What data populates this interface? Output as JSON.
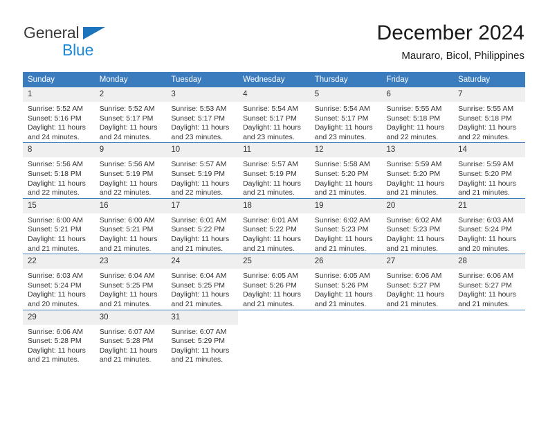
{
  "brand": {
    "name_part1": "General",
    "name_part2": "Blue",
    "triangle_color": "#1c75bc"
  },
  "header": {
    "title": "December 2024",
    "subtitle": "Mauraro, Bicol, Philippines"
  },
  "colors": {
    "header_blue": "#3b7cbf",
    "daynum_gray": "#efefef",
    "brand_blue": "#1c8ad6",
    "text": "#333333"
  },
  "weekday_headers": [
    "Sunday",
    "Monday",
    "Tuesday",
    "Wednesday",
    "Thursday",
    "Friday",
    "Saturday"
  ],
  "labels": {
    "sunrise_prefix": "Sunrise:",
    "sunset_prefix": "Sunset:",
    "daylight_prefix": "Daylight:"
  },
  "weeks": [
    [
      {
        "day": "1",
        "sunrise": "Sunrise: 5:52 AM",
        "sunset": "Sunset: 5:16 PM",
        "daylight": "Daylight: 11 hours and 24 minutes."
      },
      {
        "day": "2",
        "sunrise": "Sunrise: 5:52 AM",
        "sunset": "Sunset: 5:17 PM",
        "daylight": "Daylight: 11 hours and 24 minutes."
      },
      {
        "day": "3",
        "sunrise": "Sunrise: 5:53 AM",
        "sunset": "Sunset: 5:17 PM",
        "daylight": "Daylight: 11 hours and 23 minutes."
      },
      {
        "day": "4",
        "sunrise": "Sunrise: 5:54 AM",
        "sunset": "Sunset: 5:17 PM",
        "daylight": "Daylight: 11 hours and 23 minutes."
      },
      {
        "day": "5",
        "sunrise": "Sunrise: 5:54 AM",
        "sunset": "Sunset: 5:17 PM",
        "daylight": "Daylight: 11 hours and 23 minutes."
      },
      {
        "day": "6",
        "sunrise": "Sunrise: 5:55 AM",
        "sunset": "Sunset: 5:18 PM",
        "daylight": "Daylight: 11 hours and 22 minutes."
      },
      {
        "day": "7",
        "sunrise": "Sunrise: 5:55 AM",
        "sunset": "Sunset: 5:18 PM",
        "daylight": "Daylight: 11 hours and 22 minutes."
      }
    ],
    [
      {
        "day": "8",
        "sunrise": "Sunrise: 5:56 AM",
        "sunset": "Sunset: 5:18 PM",
        "daylight": "Daylight: 11 hours and 22 minutes."
      },
      {
        "day": "9",
        "sunrise": "Sunrise: 5:56 AM",
        "sunset": "Sunset: 5:19 PM",
        "daylight": "Daylight: 11 hours and 22 minutes."
      },
      {
        "day": "10",
        "sunrise": "Sunrise: 5:57 AM",
        "sunset": "Sunset: 5:19 PM",
        "daylight": "Daylight: 11 hours and 22 minutes."
      },
      {
        "day": "11",
        "sunrise": "Sunrise: 5:57 AM",
        "sunset": "Sunset: 5:19 PM",
        "daylight": "Daylight: 11 hours and 21 minutes."
      },
      {
        "day": "12",
        "sunrise": "Sunrise: 5:58 AM",
        "sunset": "Sunset: 5:20 PM",
        "daylight": "Daylight: 11 hours and 21 minutes."
      },
      {
        "day": "13",
        "sunrise": "Sunrise: 5:59 AM",
        "sunset": "Sunset: 5:20 PM",
        "daylight": "Daylight: 11 hours and 21 minutes."
      },
      {
        "day": "14",
        "sunrise": "Sunrise: 5:59 AM",
        "sunset": "Sunset: 5:20 PM",
        "daylight": "Daylight: 11 hours and 21 minutes."
      }
    ],
    [
      {
        "day": "15",
        "sunrise": "Sunrise: 6:00 AM",
        "sunset": "Sunset: 5:21 PM",
        "daylight": "Daylight: 11 hours and 21 minutes."
      },
      {
        "day": "16",
        "sunrise": "Sunrise: 6:00 AM",
        "sunset": "Sunset: 5:21 PM",
        "daylight": "Daylight: 11 hours and 21 minutes."
      },
      {
        "day": "17",
        "sunrise": "Sunrise: 6:01 AM",
        "sunset": "Sunset: 5:22 PM",
        "daylight": "Daylight: 11 hours and 21 minutes."
      },
      {
        "day": "18",
        "sunrise": "Sunrise: 6:01 AM",
        "sunset": "Sunset: 5:22 PM",
        "daylight": "Daylight: 11 hours and 21 minutes."
      },
      {
        "day": "19",
        "sunrise": "Sunrise: 6:02 AM",
        "sunset": "Sunset: 5:23 PM",
        "daylight": "Daylight: 11 hours and 21 minutes."
      },
      {
        "day": "20",
        "sunrise": "Sunrise: 6:02 AM",
        "sunset": "Sunset: 5:23 PM",
        "daylight": "Daylight: 11 hours and 21 minutes."
      },
      {
        "day": "21",
        "sunrise": "Sunrise: 6:03 AM",
        "sunset": "Sunset: 5:24 PM",
        "daylight": "Daylight: 11 hours and 20 minutes."
      }
    ],
    [
      {
        "day": "22",
        "sunrise": "Sunrise: 6:03 AM",
        "sunset": "Sunset: 5:24 PM",
        "daylight": "Daylight: 11 hours and 20 minutes."
      },
      {
        "day": "23",
        "sunrise": "Sunrise: 6:04 AM",
        "sunset": "Sunset: 5:25 PM",
        "daylight": "Daylight: 11 hours and 21 minutes."
      },
      {
        "day": "24",
        "sunrise": "Sunrise: 6:04 AM",
        "sunset": "Sunset: 5:25 PM",
        "daylight": "Daylight: 11 hours and 21 minutes."
      },
      {
        "day": "25",
        "sunrise": "Sunrise: 6:05 AM",
        "sunset": "Sunset: 5:26 PM",
        "daylight": "Daylight: 11 hours and 21 minutes."
      },
      {
        "day": "26",
        "sunrise": "Sunrise: 6:05 AM",
        "sunset": "Sunset: 5:26 PM",
        "daylight": "Daylight: 11 hours and 21 minutes."
      },
      {
        "day": "27",
        "sunrise": "Sunrise: 6:06 AM",
        "sunset": "Sunset: 5:27 PM",
        "daylight": "Daylight: 11 hours and 21 minutes."
      },
      {
        "day": "28",
        "sunrise": "Sunrise: 6:06 AM",
        "sunset": "Sunset: 5:27 PM",
        "daylight": "Daylight: 11 hours and 21 minutes."
      }
    ],
    [
      {
        "day": "29",
        "sunrise": "Sunrise: 6:06 AM",
        "sunset": "Sunset: 5:28 PM",
        "daylight": "Daylight: 11 hours and 21 minutes."
      },
      {
        "day": "30",
        "sunrise": "Sunrise: 6:07 AM",
        "sunset": "Sunset: 5:28 PM",
        "daylight": "Daylight: 11 hours and 21 minutes."
      },
      {
        "day": "31",
        "sunrise": "Sunrise: 6:07 AM",
        "sunset": "Sunset: 5:29 PM",
        "daylight": "Daylight: 11 hours and 21 minutes."
      },
      {
        "day": "",
        "sunrise": "",
        "sunset": "",
        "daylight": ""
      },
      {
        "day": "",
        "sunrise": "",
        "sunset": "",
        "daylight": ""
      },
      {
        "day": "",
        "sunrise": "",
        "sunset": "",
        "daylight": ""
      },
      {
        "day": "",
        "sunrise": "",
        "sunset": "",
        "daylight": ""
      }
    ]
  ]
}
